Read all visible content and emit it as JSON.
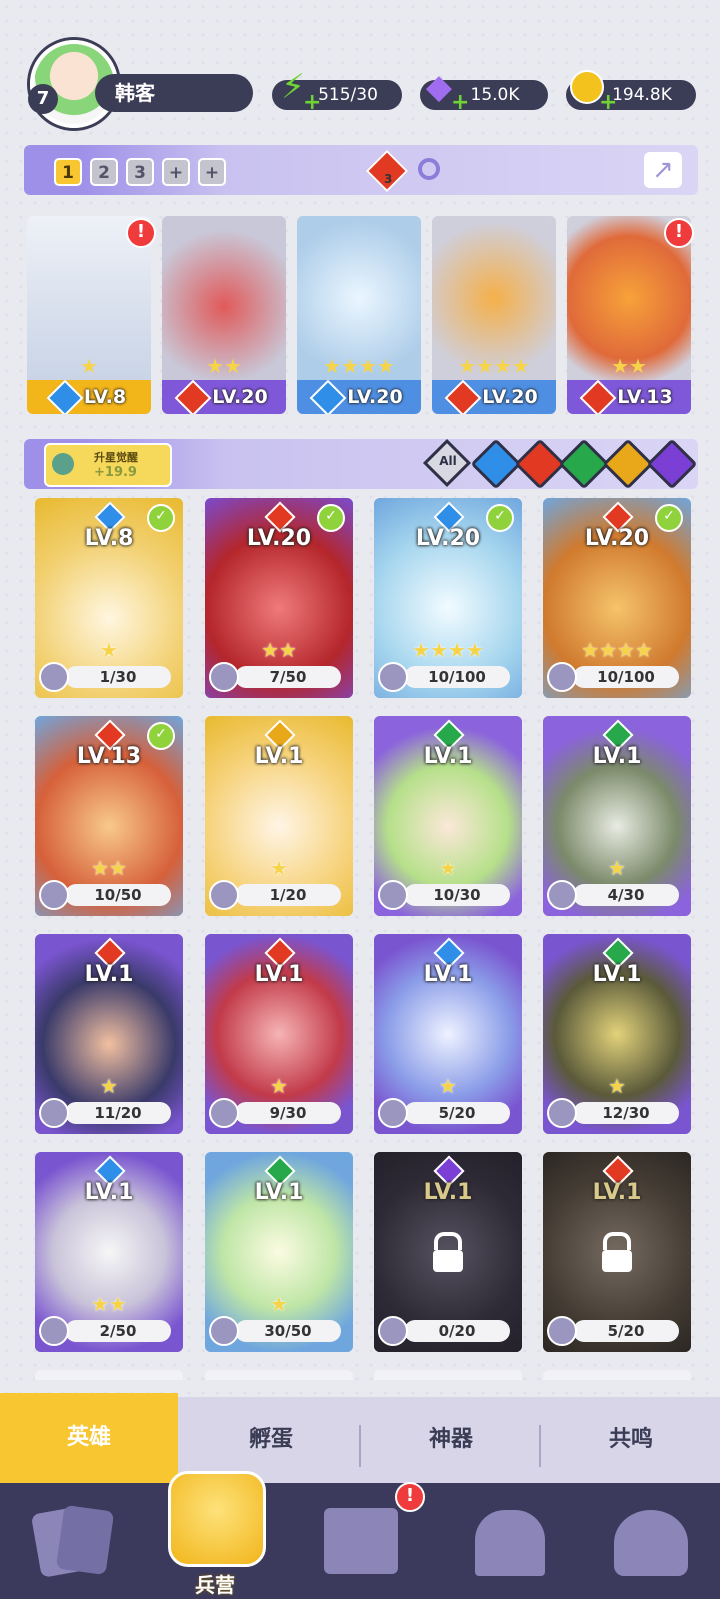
{
  "player": {
    "level": "7",
    "name": "韩客"
  },
  "resources": {
    "energy": "515/30",
    "gems": "15.0K",
    "coins": "194.8K"
  },
  "team_tabs": [
    "1",
    "2",
    "3",
    "+",
    "+"
  ],
  "team_badge_count": "3",
  "lineup": [
    {
      "level": "LV.8",
      "element": "water",
      "stars": "★",
      "alert": "!"
    },
    {
      "level": "LV.20",
      "element": "fire",
      "stars": "★★",
      "alert": ""
    },
    {
      "level": "LV.20",
      "element": "water",
      "stars": "★★★★",
      "alert": ""
    },
    {
      "level": "LV.20",
      "element": "fire",
      "stars": "★★★★",
      "alert": ""
    },
    {
      "level": "LV.13",
      "element": "fire",
      "stars": "★★",
      "alert": "!"
    }
  ],
  "awaken": {
    "label": "升星觉醒",
    "value": "+19.9"
  },
  "filters": {
    "all_label": "All"
  },
  "heroes": [
    {
      "level": "LV.8",
      "element": "water",
      "fragments": "1/30",
      "stars": "★",
      "checked": true,
      "locked": false
    },
    {
      "level": "LV.20",
      "element": "fire",
      "fragments": "7/50",
      "stars": "★★",
      "checked": true,
      "locked": false
    },
    {
      "level": "LV.20",
      "element": "water",
      "fragments": "10/100",
      "stars": "★★★★",
      "checked": true,
      "locked": false
    },
    {
      "level": "LV.20",
      "element": "fire",
      "fragments": "10/100",
      "stars": "★★★★",
      "checked": true,
      "locked": false
    },
    {
      "level": "LV.13",
      "element": "fire",
      "fragments": "10/50",
      "stars": "★★",
      "checked": true,
      "locked": false
    },
    {
      "level": "LV.1",
      "element": "light",
      "fragments": "1/20",
      "stars": "★",
      "checked": false,
      "locked": false
    },
    {
      "level": "LV.1",
      "element": "nature",
      "fragments": "10/30",
      "stars": "★",
      "checked": false,
      "locked": false
    },
    {
      "level": "LV.1",
      "element": "nature",
      "fragments": "4/30",
      "stars": "★",
      "checked": false,
      "locked": false
    },
    {
      "level": "LV.1",
      "element": "fire",
      "fragments": "11/20",
      "stars": "★",
      "checked": false,
      "locked": false
    },
    {
      "level": "LV.1",
      "element": "fire",
      "fragments": "9/30",
      "stars": "★",
      "checked": false,
      "locked": false
    },
    {
      "level": "LV.1",
      "element": "water",
      "fragments": "5/20",
      "stars": "★",
      "checked": false,
      "locked": false
    },
    {
      "level": "LV.1",
      "element": "nature",
      "fragments": "12/30",
      "stars": "★",
      "checked": false,
      "locked": false
    },
    {
      "level": "LV.1",
      "element": "water",
      "fragments": "2/50",
      "stars": "★★",
      "checked": false,
      "locked": false
    },
    {
      "level": "LV.1",
      "element": "nature",
      "fragments": "30/50",
      "stars": "★",
      "checked": false,
      "locked": false
    },
    {
      "level": "LV.1",
      "element": "dark",
      "fragments": "0/20",
      "stars": "",
      "checked": false,
      "locked": true
    },
    {
      "level": "LV.1",
      "element": "fire",
      "fragments": "5/20",
      "stars": "",
      "checked": false,
      "locked": true
    }
  ],
  "subtabs": [
    "英雄",
    "孵蛋",
    "神器",
    "共鸣"
  ],
  "nav": {
    "center_label": "兵营",
    "map_alert": "!"
  },
  "colors": {
    "water": "#2f8fe8",
    "fire": "#e23a22",
    "nature": "#27a84a",
    "light": "#e9a81a",
    "dark": "#7b3fd6",
    "accent": "#f7c630",
    "nav_bg": "#3b3a5c"
  }
}
